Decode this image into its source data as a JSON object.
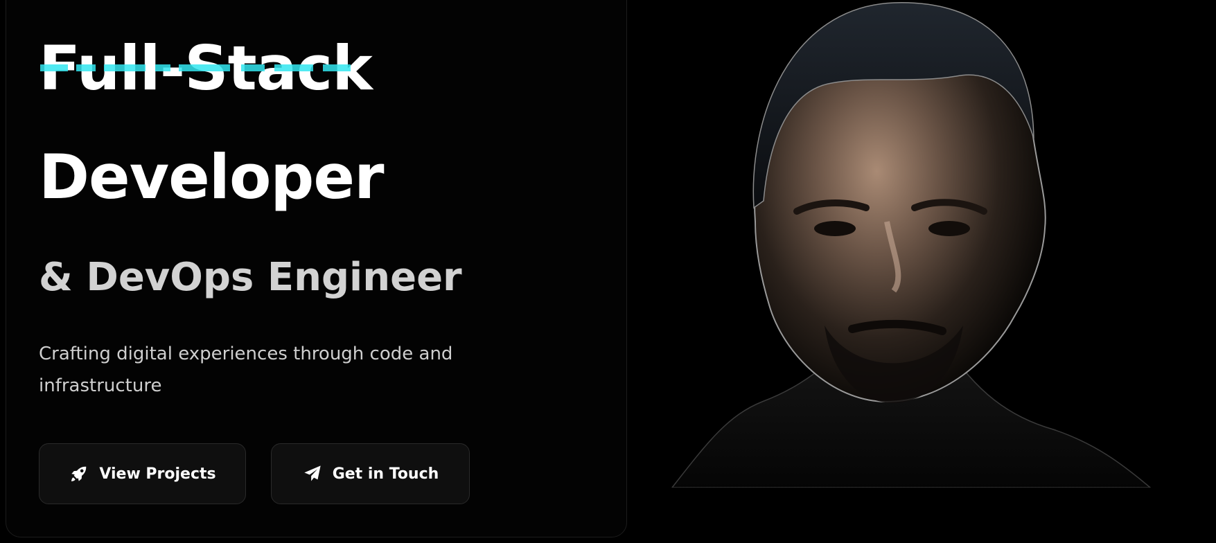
{
  "hero": {
    "title_line_1": "Full-Stack",
    "title_line_2": "Developer",
    "subtitle": "& DevOps Engineer",
    "tagline": "Crafting digital experiences through code and infrastructure",
    "accent_color": "#33e6f0"
  },
  "actions": {
    "primary": {
      "label": "View Projects",
      "icon": "rocket-icon"
    },
    "secondary": {
      "label": "Get in Touch",
      "icon": "paper-plane-icon"
    }
  },
  "portrait": {
    "icon": "profile-photo"
  },
  "theme": {
    "background": "#000000",
    "card_border": "#1c1c1c",
    "button_background": "#0f0f0f",
    "button_border": "#2a2a2a",
    "text_primary": "#ffffff",
    "text_secondary": "#d2d2d2"
  }
}
